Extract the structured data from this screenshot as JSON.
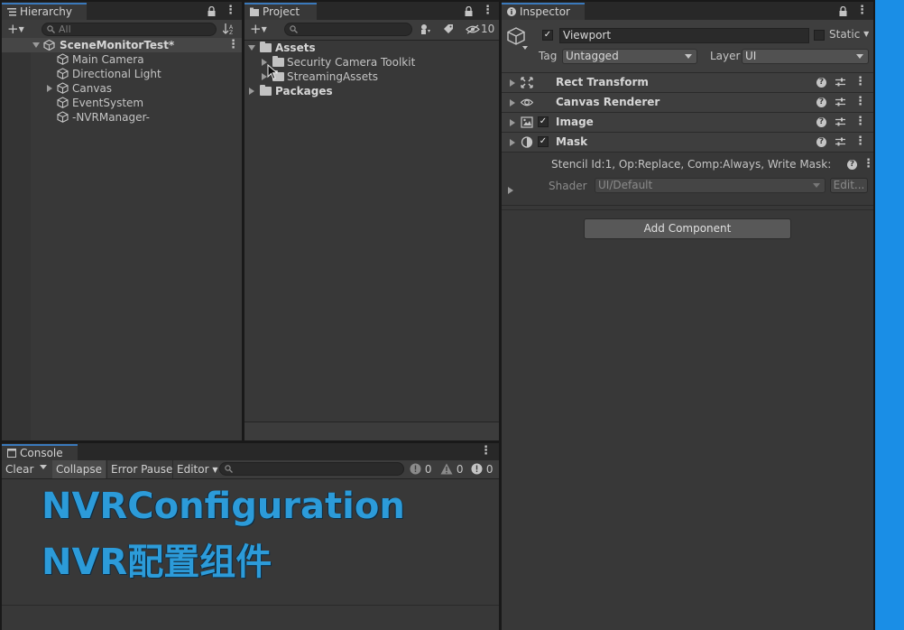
{
  "hierarchy": {
    "tab_label": "Hierarchy",
    "search_placeholder": "All",
    "scene_name": "SceneMonitorTest*",
    "items": [
      {
        "label": "Main Camera"
      },
      {
        "label": "Directional Light"
      },
      {
        "label": "Canvas"
      },
      {
        "label": "EventSystem"
      },
      {
        "label": "-NVRManager-"
      }
    ]
  },
  "project": {
    "tab_label": "Project",
    "hidden_count": "10",
    "tree": {
      "assets": "Assets",
      "children": [
        {
          "label": "Security Camera Toolkit"
        },
        {
          "label": "StreamingAssets"
        }
      ],
      "packages": "Packages"
    }
  },
  "inspector": {
    "tab_label": "Inspector",
    "object_name": "Viewport",
    "static_label": "Static",
    "tag_label": "Tag",
    "tag_value": "Untagged",
    "layer_label": "Layer",
    "layer_value": "UI",
    "components": [
      {
        "name": "Rect Transform",
        "icon": "rect-transform-icon"
      },
      {
        "name": "Canvas Renderer",
        "icon": "eye-icon"
      },
      {
        "name": "Image",
        "icon": "image-icon"
      },
      {
        "name": "Mask",
        "icon": "mask-icon"
      }
    ],
    "material_info": "Stencil Id:1, Op:Replace, Comp:Always, Write Mask:",
    "shader_label": "Shader",
    "shader_value": "UI/Default",
    "edit_button": "Edit...",
    "add_component": "Add Component"
  },
  "console": {
    "tab_label": "Console",
    "clear_label": "Clear",
    "collapse_label": "Collapse",
    "error_pause_label": "Error Pause",
    "editor_label": "Editor",
    "log_count": "0",
    "warning_count": "0",
    "error_count": "0"
  },
  "overlay": {
    "line1": "NVRConfiguration",
    "line2": "NVR配置组件"
  },
  "colors": {
    "accent": "#3a79bb",
    "overlay_text": "#2c9bd9",
    "side_bar": "#1a8ee6"
  }
}
